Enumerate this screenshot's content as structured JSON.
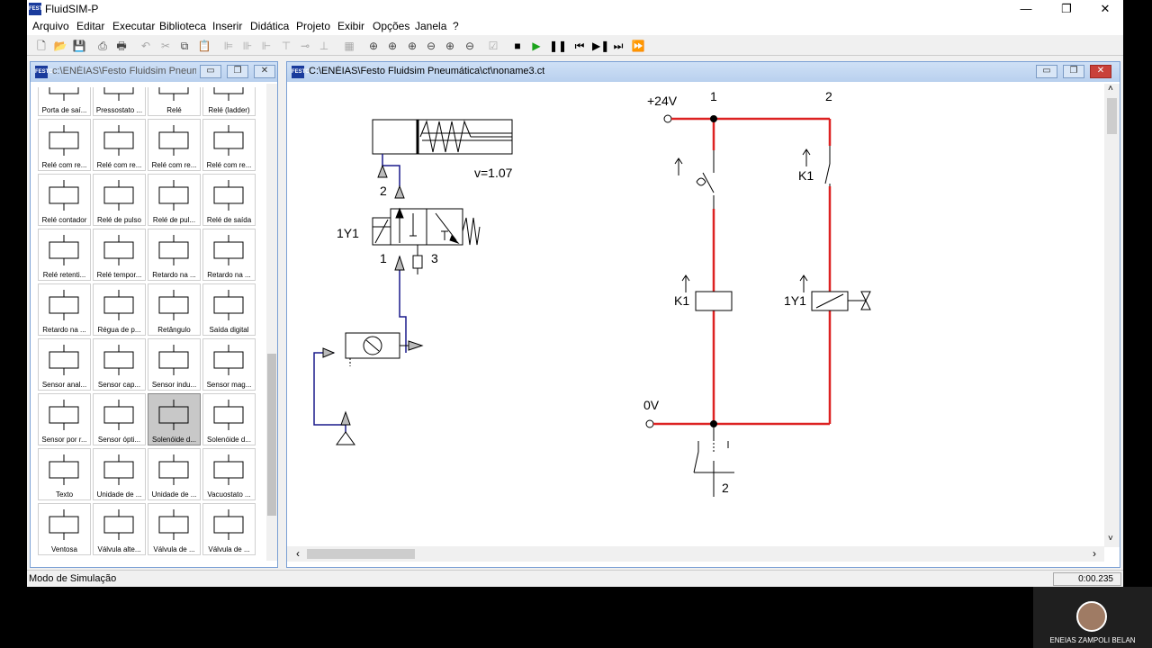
{
  "app": {
    "title": "FluidSIM-P",
    "logo": "FESTO",
    "window_buttons": [
      "—",
      "❐",
      "✕"
    ]
  },
  "menu": [
    "Arquivo",
    "Editar",
    "Executar",
    "Biblioteca",
    "Inserir",
    "Didática",
    "Projeto",
    "Exibir",
    "Opções",
    "Janela",
    "?"
  ],
  "toolbar": {
    "icons": [
      "new-icon",
      "open-icon",
      "save-icon",
      "print-preview-icon",
      "print-icon",
      "undo-icon",
      "cut-icon",
      "copy-icon",
      "paste-icon",
      "align-left-icon",
      "align-center-icon",
      "align-right-icon",
      "align-top-icon",
      "align-middle-icon",
      "align-bottom-icon",
      "grid-icon",
      "zoom-fit-icon",
      "zoom-area-icon",
      "zoom-window-icon",
      "zoom-prev-icon",
      "zoom-in-icon",
      "zoom-out-icon",
      "check-icon",
      "stop-icon",
      "play-icon",
      "pause-icon",
      "reset-icon",
      "step-icon",
      "step-end-icon",
      "fast-forward-icon"
    ]
  },
  "library_window": {
    "title": "c:\\ENÉIAS\\Festo Fluidsim Pneuma...",
    "items": [
      "Porta de saí...",
      "Pressostato ...",
      "Relé",
      "Relé (ladder)",
      "Relé com re...",
      "Relé com re...",
      "Relé com re...",
      "Relé com re...",
      "Relé contador",
      "Relé de pulso",
      "Relé de pul...",
      "Relé de saída",
      "Relé retenti...",
      "Relé tempor...",
      "Retardo na ...",
      "Retardo na ...",
      "Retardo na ...",
      "Régua de p...",
      "Retângulo",
      "Saída digital",
      "Sensor anal...",
      "Sensor cap...",
      "Sensor indu...",
      "Sensor mag...",
      "Sensor por r...",
      "Sensor ópti...",
      "Solenóide d...",
      "Solenóide d...",
      "Texto",
      "Unidade de ...",
      "Unidade de ...",
      "Vacuostato ...",
      "Ventosa",
      "Válvula alte...",
      "Válvula de ...",
      "Válvula de ..."
    ],
    "selected_index": 26,
    "cell_icons": [
      "output-port-icon",
      "pressure-switch-icon",
      "relay-icon",
      "relay-ladder-icon",
      "relay-crossed-icon",
      "relay-sa-icon",
      "relay-filled-icon",
      "relay-sr-icon",
      "counter-relay-icon",
      "pulse-relay-icon",
      "pulse-relay-icon",
      "output-relay-icon",
      "retentive-relay-icon",
      "timer-relay-icon",
      "delay-relay-icon",
      "delay-relay-icon",
      "delay-relay-icon",
      "ruler-icon",
      "rectangle-icon",
      "digital-output-icon",
      "analog-sensor-icon",
      "capacitive-sensor-icon",
      "inductive-sensor-icon",
      "magnetic-sensor-icon",
      "reflex-sensor-icon",
      "optical-sensor-icon",
      "solenoid-valve-icon",
      "solenoid-coil-icon",
      "text-icon",
      "service-unit-icon",
      "service-unit-icon",
      "vacuum-switch-icon",
      "suction-cup-icon",
      "shuttle-valve-icon",
      "valve-icon",
      "valve-icon"
    ]
  },
  "circuit_window": {
    "title": "C:\\ENÉIAS\\Festo Fluidsim Pneumática\\ct\\noname3.ct",
    "pneumatic": {
      "velocity_label": "v=1.07",
      "port_2": "2",
      "port_1": "1",
      "port_3": "3",
      "solenoid_label": "1Y1"
    },
    "electrical": {
      "supply_label": "+24V",
      "ground_label": "0V",
      "path_1": "1",
      "path_2": "2",
      "k1_contact_label": "K1",
      "k1_coil_label": "K1",
      "y1_coil_label": "1Y1",
      "button_ref": "2"
    },
    "colors": {
      "energized_wire": "#dd2222",
      "pressure_line": "#1a1a8c"
    }
  },
  "status": {
    "mode": "Modo de Simulação",
    "time": "0:00.235"
  },
  "webcam": {
    "name": "ENEIAS ZAMPOLI BELAN"
  }
}
